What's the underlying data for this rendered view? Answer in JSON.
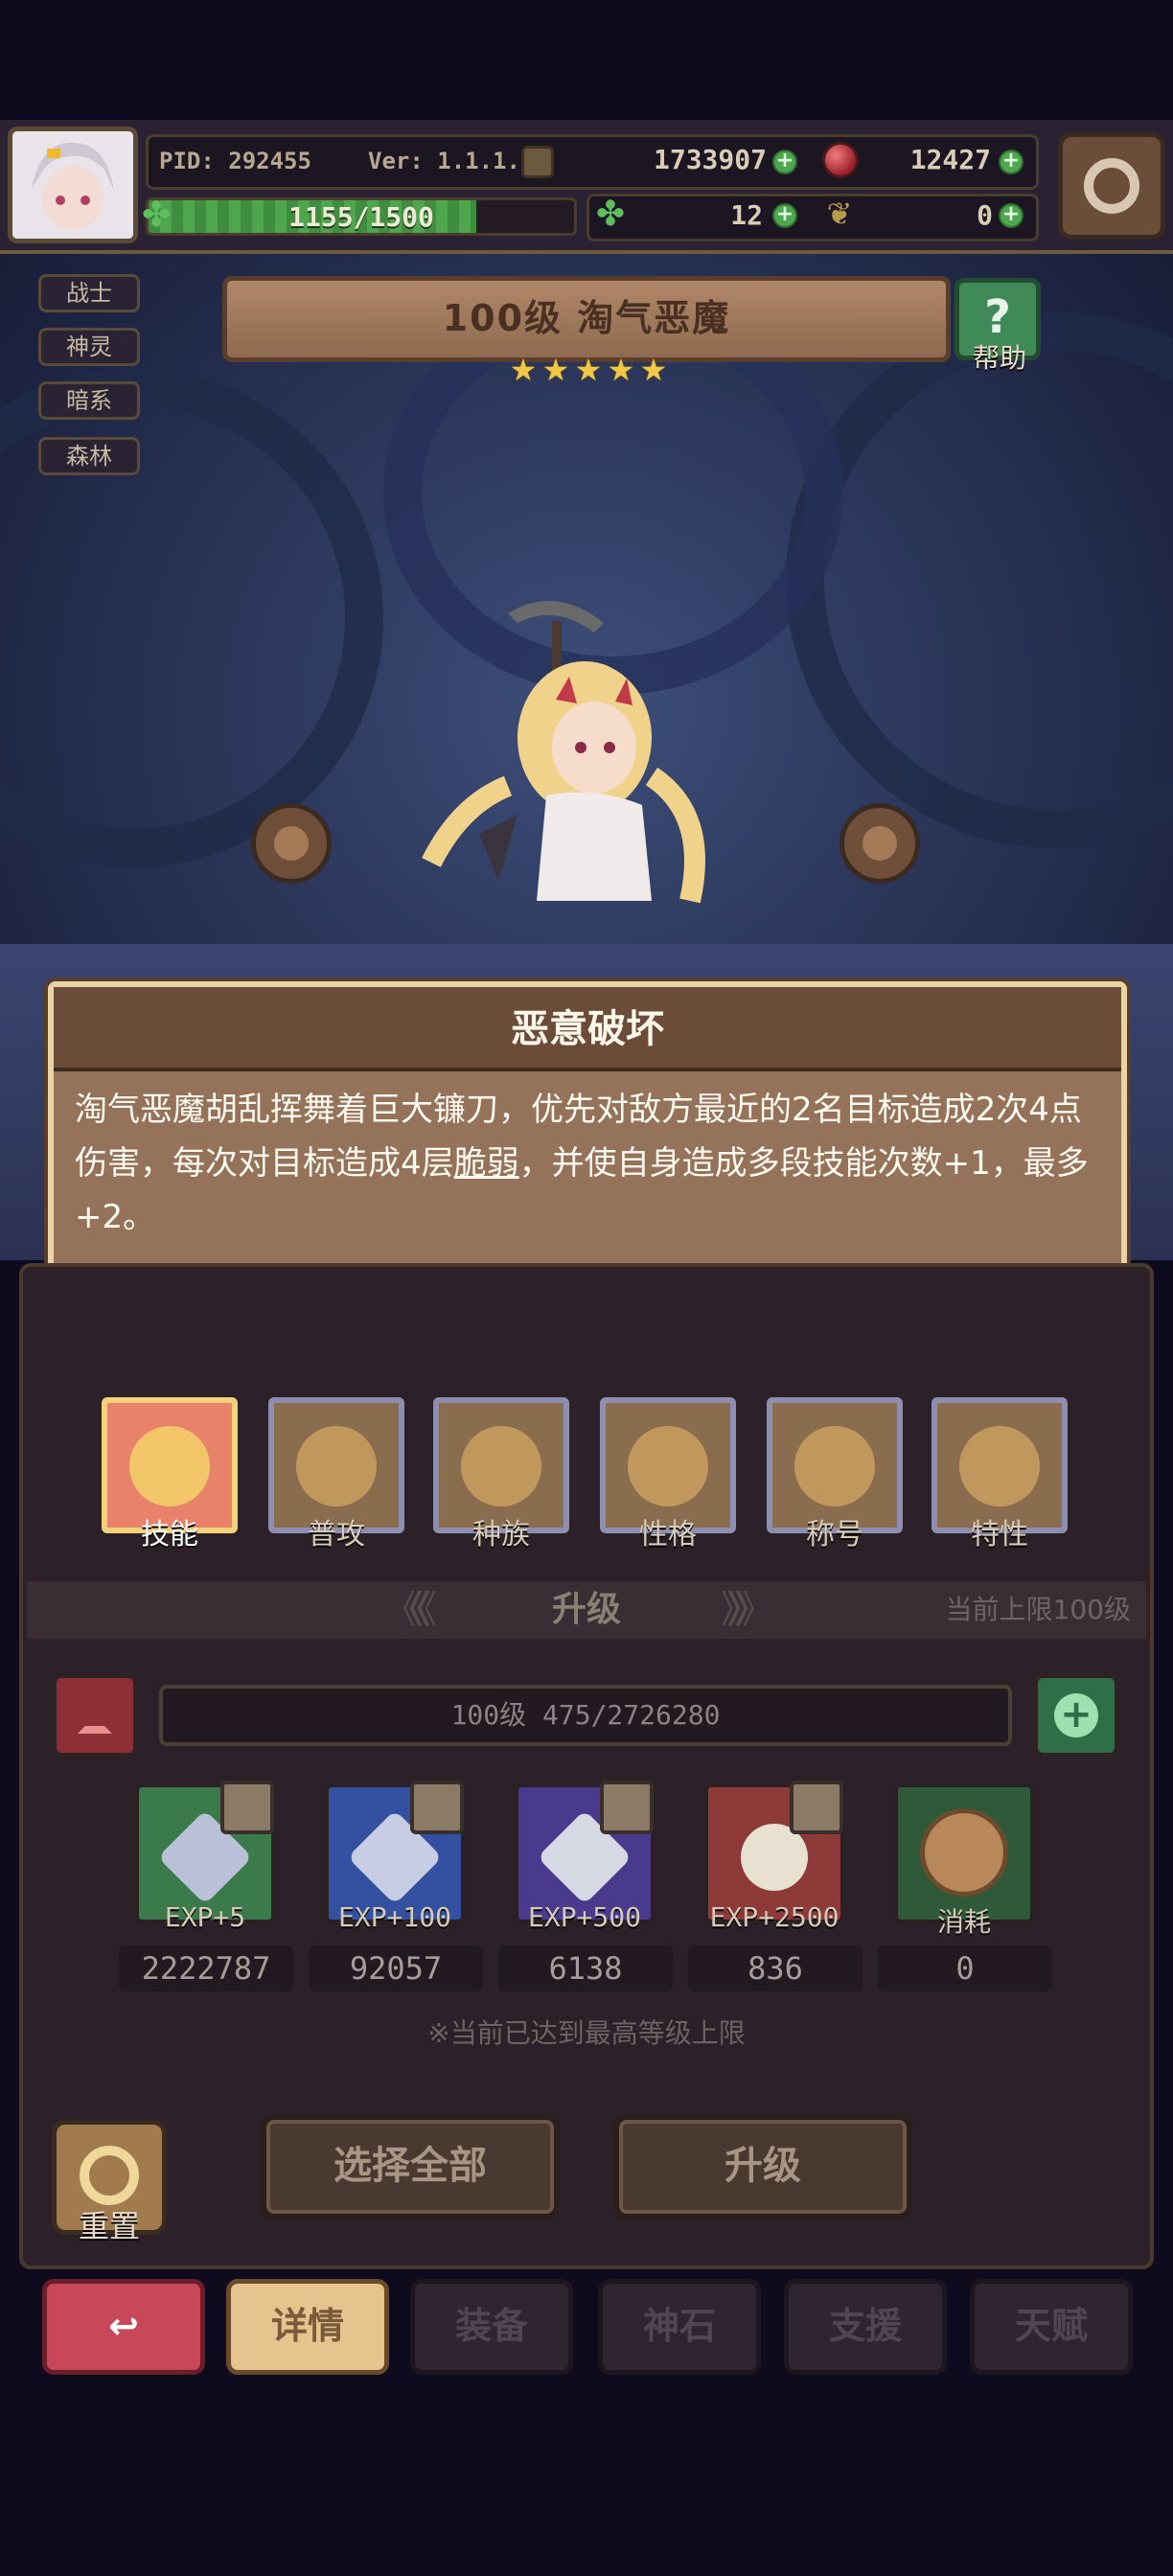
{
  "header": {
    "pid": "PID: 292455",
    "version": "Ver: 1.1.1.8",
    "gold": "1733907",
    "gems": "12427",
    "exp": "1155/1500",
    "exp_fraction": 0.77,
    "clover_count": "12",
    "leaf_count": "0"
  },
  "tags": [
    "战士",
    "神灵",
    "暗系",
    "森林"
  ],
  "hero": {
    "title": "100级  淘气恶魔",
    "stars": 5,
    "help_label": "帮助"
  },
  "skill": {
    "name": "恶意破坏",
    "desc_part1": "淘气恶魔胡乱挥舞着巨大镰刀，优先对敌方最近的2名目标造成2次4点伤害，每次对目标造成4层",
    "desc_keyword": "脆弱",
    "desc_part2": "，并使自身造成多段技能次数+1，最多+2。"
  },
  "tabs": [
    {
      "label": "技能",
      "active": true
    },
    {
      "label": "普攻",
      "active": false
    },
    {
      "label": "种族",
      "active": false
    },
    {
      "label": "性格",
      "active": false
    },
    {
      "label": "称号",
      "active": false
    },
    {
      "label": "特性",
      "active": false
    }
  ],
  "upgrade": {
    "section_title": "升级",
    "limit_text": "当前上限100级",
    "level_text": "100级  475/2726280",
    "items": [
      {
        "label": "EXP+5",
        "count": "2222787"
      },
      {
        "label": "EXP+100",
        "count": "92057"
      },
      {
        "label": "EXP+500",
        "count": "6138"
      },
      {
        "label": "EXP+2500",
        "count": "836"
      },
      {
        "label": "消耗",
        "count": "0"
      }
    ],
    "notice": "※当前已达到最高等级上限",
    "reset_label": "重置",
    "select_all_label": "选择全部",
    "upgrade_label": "升级"
  },
  "nav": {
    "items": [
      "详情",
      "装备",
      "神石",
      "支援",
      "天赋"
    ]
  },
  "colors": {
    "accent_gold": "#f0c845",
    "active_tab": "#e8826a",
    "back_button": "#c8485a",
    "plus_green": "#4ea64e"
  }
}
